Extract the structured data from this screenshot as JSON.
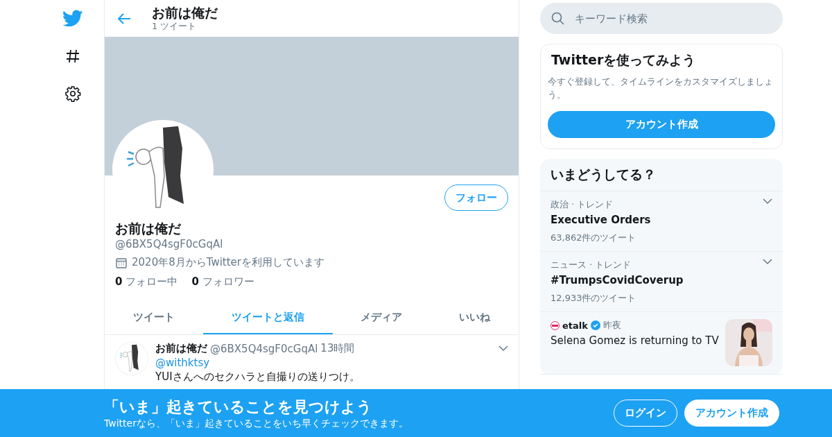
{
  "nav": {
    "items": [
      {
        "kind": "logo"
      },
      {
        "kind": "explore"
      },
      {
        "kind": "settings"
      }
    ]
  },
  "header": {
    "title": "お前は俺だ",
    "subtitle": "1 ツイート"
  },
  "profile": {
    "follow_button": "フォロー",
    "name": "お前は俺だ",
    "handle": "@6BX5Q4sgF0cGqAl",
    "joined": "2020年8月からTwitterを利用しています",
    "stats": [
      {
        "count": "0",
        "label": "フォロー中"
      },
      {
        "count": "0",
        "label": "フォロワー"
      }
    ]
  },
  "tabs": [
    {
      "label": "ツイート",
      "selected": false
    },
    {
      "label": "ツイートと返信",
      "selected": true
    },
    {
      "label": "メディア",
      "selected": false
    },
    {
      "label": "いいね",
      "selected": false
    }
  ],
  "tweet": {
    "name": "お前は俺だ",
    "handle": "@6BX5Q4sgF0cGqAl",
    "time": "13時間",
    "reply_to": "@withktsy",
    "text": "YUIさんへのセクハラと自撮りの送りつけ。"
  },
  "search": {
    "placeholder": "キーワード検索"
  },
  "signup_card": {
    "title": "Twitterを使ってみよう",
    "text": "今すぐ登録して、タイムラインをカスタマイズしましょう。",
    "button": "アカウント作成"
  },
  "trends": {
    "title": "いまどうしてる？",
    "items": [
      {
        "kind": "trend",
        "context": "政治 · トレンド",
        "name": "Executive Orders",
        "count": "63,862件のツイート"
      },
      {
        "kind": "trend",
        "context": "ニュース · トレンド",
        "name": "#TrumpsCovidCoverup",
        "count": "12,933件のツイート"
      },
      {
        "kind": "story",
        "source": "etalk",
        "time": "昨夜",
        "headline": "Selena Gomez is returning to TV"
      }
    ]
  },
  "bottom_bar": {
    "title": "「いま」起きていることを見つけよう",
    "text": "Twitterなら、「いま」起きていることをいち早くチェックできます。",
    "buttons": [
      {
        "kind": "outline",
        "label": "ログイン"
      },
      {
        "kind": "solid",
        "label": "アカウント作成"
      }
    ]
  }
}
